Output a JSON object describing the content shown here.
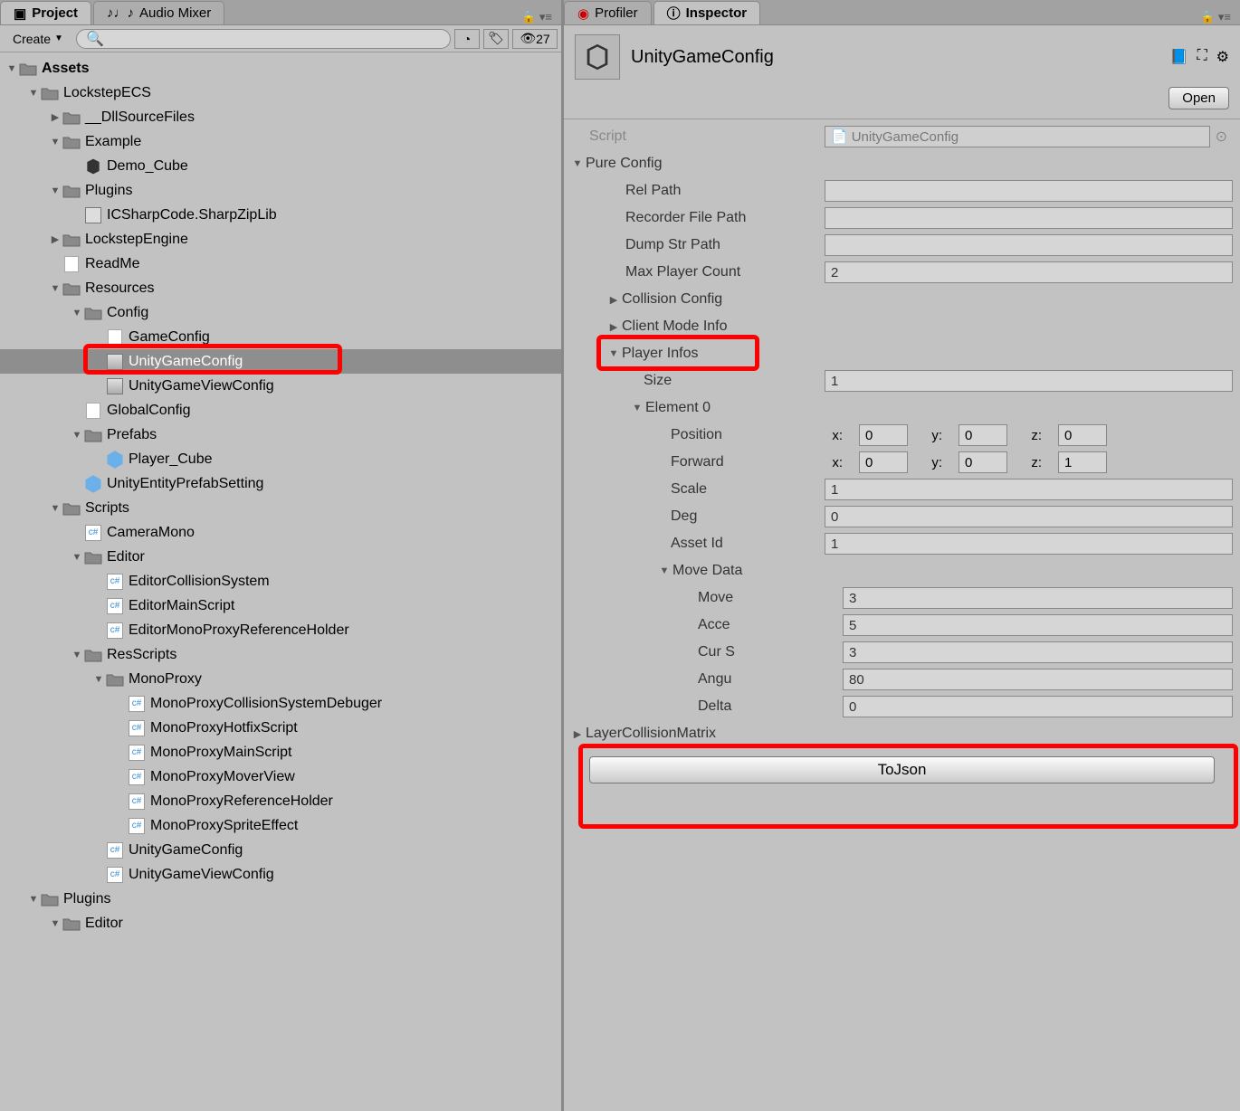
{
  "tabs_left": [
    {
      "label": "Project",
      "icon": "folder-icon",
      "active": true
    },
    {
      "label": "Audio Mixer",
      "icon": "mixer-icon",
      "active": false
    }
  ],
  "tabs_right": [
    {
      "label": "Profiler",
      "icon": "profiler-icon",
      "active": false
    },
    {
      "label": "Inspector",
      "icon": "info-icon",
      "active": true
    }
  ],
  "toolbar": {
    "create_label": "Create",
    "hidden_count": "27"
  },
  "tree": [
    {
      "d": 0,
      "label": "Assets",
      "icon": "folder",
      "arrow": "down",
      "bold": true
    },
    {
      "d": 1,
      "label": "LockstepECS",
      "icon": "folder",
      "arrow": "down"
    },
    {
      "d": 2,
      "label": "__DllSourceFiles",
      "icon": "folder",
      "arrow": "right"
    },
    {
      "d": 2,
      "label": "Example",
      "icon": "folder",
      "arrow": "down"
    },
    {
      "d": 3,
      "label": "Demo_Cube",
      "icon": "unity",
      "arrow": ""
    },
    {
      "d": 2,
      "label": "Plugins",
      "icon": "folder",
      "arrow": "down"
    },
    {
      "d": 3,
      "label": "ICSharpCode.SharpZipLib",
      "icon": "dll",
      "arrow": ""
    },
    {
      "d": 2,
      "label": "LockstepEngine",
      "icon": "folder",
      "arrow": "right"
    },
    {
      "d": 2,
      "label": "ReadMe",
      "icon": "text",
      "arrow": ""
    },
    {
      "d": 2,
      "label": "Resources",
      "icon": "folder",
      "arrow": "down"
    },
    {
      "d": 3,
      "label": "Config",
      "icon": "folder",
      "arrow": "down"
    },
    {
      "d": 4,
      "label": "GameConfig",
      "icon": "text",
      "arrow": ""
    },
    {
      "d": 4,
      "label": "UnityGameConfig",
      "icon": "asset",
      "arrow": "",
      "selected": true
    },
    {
      "d": 4,
      "label": "UnityGameViewConfig",
      "icon": "asset",
      "arrow": ""
    },
    {
      "d": 3,
      "label": "GlobalConfig",
      "icon": "text",
      "arrow": ""
    },
    {
      "d": 3,
      "label": "Prefabs",
      "icon": "folder",
      "arrow": "down"
    },
    {
      "d": 4,
      "label": "Player_Cube",
      "icon": "cube",
      "arrow": ""
    },
    {
      "d": 3,
      "label": "UnityEntityPrefabSetting",
      "icon": "cube",
      "arrow": ""
    },
    {
      "d": 2,
      "label": "Scripts",
      "icon": "folder",
      "arrow": "down"
    },
    {
      "d": 3,
      "label": "CameraMono",
      "icon": "cs",
      "arrow": ""
    },
    {
      "d": 3,
      "label": "Editor",
      "icon": "folder",
      "arrow": "down"
    },
    {
      "d": 4,
      "label": "EditorCollisionSystem",
      "icon": "cs",
      "arrow": ""
    },
    {
      "d": 4,
      "label": "EditorMainScript",
      "icon": "cs",
      "arrow": ""
    },
    {
      "d": 4,
      "label": "EditorMonoProxyReferenceHolder",
      "icon": "cs",
      "arrow": ""
    },
    {
      "d": 3,
      "label": "ResScripts",
      "icon": "folder",
      "arrow": "down"
    },
    {
      "d": 4,
      "label": "MonoProxy",
      "icon": "folder",
      "arrow": "down"
    },
    {
      "d": 5,
      "label": "MonoProxyCollisionSystemDebuger",
      "icon": "cs",
      "arrow": ""
    },
    {
      "d": 5,
      "label": "MonoProxyHotfixScript",
      "icon": "cs",
      "arrow": ""
    },
    {
      "d": 5,
      "label": "MonoProxyMainScript",
      "icon": "cs",
      "arrow": ""
    },
    {
      "d": 5,
      "label": "MonoProxyMoverView",
      "icon": "cs",
      "arrow": ""
    },
    {
      "d": 5,
      "label": "MonoProxyReferenceHolder",
      "icon": "cs",
      "arrow": ""
    },
    {
      "d": 5,
      "label": "MonoProxySpriteEffect",
      "icon": "cs",
      "arrow": ""
    },
    {
      "d": 4,
      "label": "UnityGameConfig",
      "icon": "cs",
      "arrow": ""
    },
    {
      "d": 4,
      "label": "UnityGameViewConfig",
      "icon": "cs",
      "arrow": ""
    },
    {
      "d": 1,
      "label": "Plugins",
      "icon": "folder",
      "arrow": "down"
    },
    {
      "d": 2,
      "label": "Editor",
      "icon": "folder",
      "arrow": "down"
    }
  ],
  "inspector": {
    "title": "UnityGameConfig",
    "open_label": "Open",
    "script_label": "Script",
    "script_value": "UnityGameConfig",
    "pure_config_label": "Pure Config",
    "rel_path_label": "Rel Path",
    "recorder_label": "Recorder File Path",
    "dump_label": "Dump Str Path",
    "max_player_label": "Max Player Count",
    "max_player_value": "2",
    "collision_label": "Collision Config",
    "client_mode_label": "Client Mode Info",
    "player_infos_label": "Player Infos",
    "size_label": "Size",
    "size_value": "1",
    "element0_label": "Element 0",
    "position_label": "Position",
    "position": {
      "x": "0",
      "y": "0",
      "z": "0"
    },
    "forward_label": "Forward",
    "forward": {
      "x": "0",
      "y": "0",
      "z": "1"
    },
    "scale_label": "Scale",
    "scale_value": "1",
    "deg_label": "Deg",
    "deg_value": "0",
    "assetid_label": "Asset Id",
    "assetid_value": "1",
    "movedata_label": "Move Data",
    "move_label": "Move",
    "move_value": "3",
    "acce_label": "Acce",
    "acce_value": "5",
    "cur_label": "Cur S",
    "cur_value": "3",
    "angu_label": "Angu",
    "angu_value": "80",
    "delta_label": "Delta",
    "delta_value": "0",
    "layer_label": "LayerCollisionMatrix",
    "tojson_label": "ToJson"
  }
}
